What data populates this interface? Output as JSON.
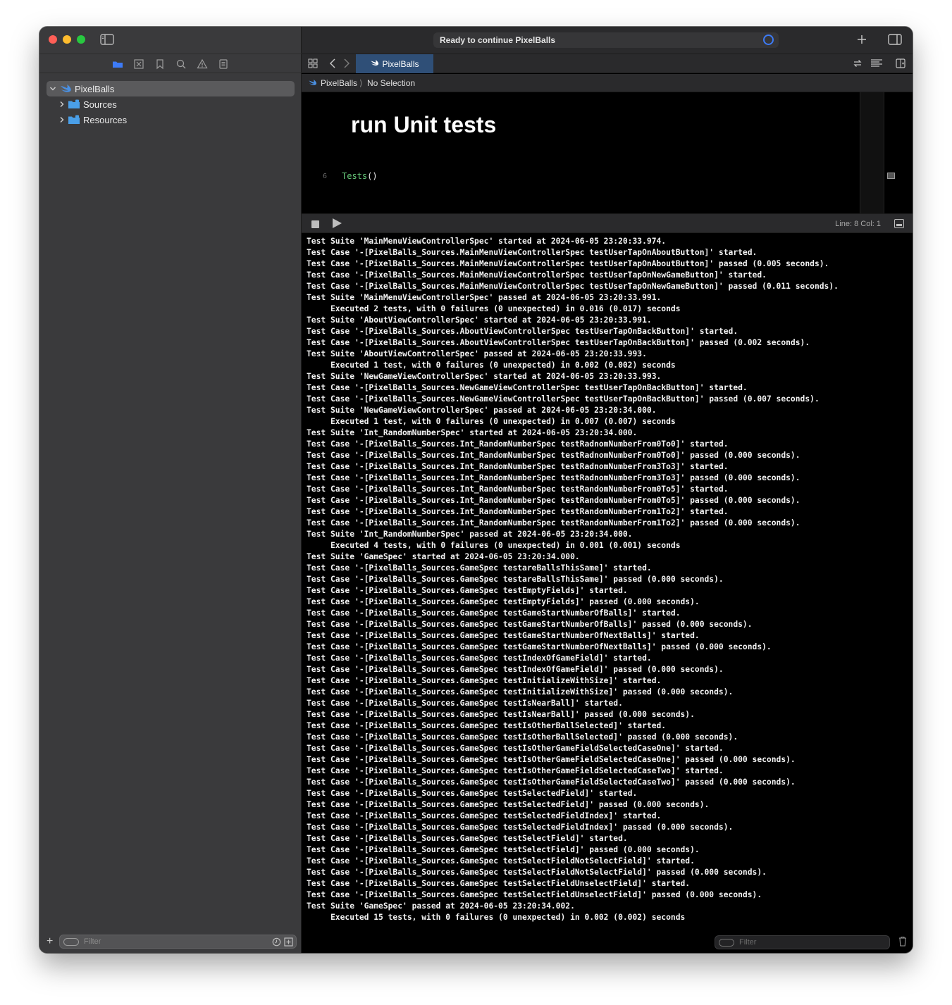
{
  "window": {
    "traffic_lights": [
      "close",
      "minimize",
      "zoom"
    ]
  },
  "navigator": {
    "icons": [
      "folder-icon",
      "source-control-icon",
      "bookmark-icon",
      "find-icon",
      "issue-icon",
      "report-icon"
    ],
    "tree": [
      {
        "label": "PixelBalls",
        "type": "project",
        "expanded": true,
        "selected": true
      },
      {
        "label": "Sources",
        "type": "folder",
        "expanded": false
      },
      {
        "label": "Resources",
        "type": "folder",
        "expanded": false
      }
    ],
    "filter_placeholder": "Filter"
  },
  "toolbar": {
    "activity_text": "Ready to continue PixelBalls",
    "accent_color": "#3d7bf7"
  },
  "tabs": [
    {
      "label": "PixelBalls",
      "active": true
    }
  ],
  "jumpbar": {
    "project": "PixelBalls",
    "selection": "No Selection"
  },
  "editor": {
    "heading": "run Unit tests",
    "line_number": "6",
    "code_fn": "Tests",
    "code_rest": "()"
  },
  "debug": {
    "line_col": "Line: 8  Col: 1"
  },
  "console": {
    "filter_placeholder": "Filter",
    "lines": [
      "Test Suite 'MainMenuViewControllerSpec' started at 2024-06-05 23:20:33.974.",
      "Test Case '-[PixelBalls_Sources.MainMenuViewControllerSpec testUserTapOnAboutButton]' started.",
      "Test Case '-[PixelBalls_Sources.MainMenuViewControllerSpec testUserTapOnAboutButton]' passed (0.005 seconds).",
      "Test Case '-[PixelBalls_Sources.MainMenuViewControllerSpec testUserTapOnNewGameButton]' started.",
      "Test Case '-[PixelBalls_Sources.MainMenuViewControllerSpec testUserTapOnNewGameButton]' passed (0.011 seconds).",
      "Test Suite 'MainMenuViewControllerSpec' passed at 2024-06-05 23:20:33.991.",
      "     Executed 2 tests, with 0 failures (0 unexpected) in 0.016 (0.017) seconds",
      "Test Suite 'AboutViewControllerSpec' started at 2024-06-05 23:20:33.991.",
      "Test Case '-[PixelBalls_Sources.AboutViewControllerSpec testUserTapOnBackButton]' started.",
      "Test Case '-[PixelBalls_Sources.AboutViewControllerSpec testUserTapOnBackButton]' passed (0.002 seconds).",
      "Test Suite 'AboutViewControllerSpec' passed at 2024-06-05 23:20:33.993.",
      "     Executed 1 test, with 0 failures (0 unexpected) in 0.002 (0.002) seconds",
      "Test Suite 'NewGameViewControllerSpec' started at 2024-06-05 23:20:33.993.",
      "Test Case '-[PixelBalls_Sources.NewGameViewControllerSpec testUserTapOnBackButton]' started.",
      "Test Case '-[PixelBalls_Sources.NewGameViewControllerSpec testUserTapOnBackButton]' passed (0.007 seconds).",
      "Test Suite 'NewGameViewControllerSpec' passed at 2024-06-05 23:20:34.000.",
      "     Executed 1 test, with 0 failures (0 unexpected) in 0.007 (0.007) seconds",
      "Test Suite 'Int_RandomNumberSpec' started at 2024-06-05 23:20:34.000.",
      "Test Case '-[PixelBalls_Sources.Int_RandomNumberSpec testRadnomNumberFrom0To0]' started.",
      "Test Case '-[PixelBalls_Sources.Int_RandomNumberSpec testRadnomNumberFrom0To0]' passed (0.000 seconds).",
      "Test Case '-[PixelBalls_Sources.Int_RandomNumberSpec testRadnomNumberFrom3To3]' started.",
      "Test Case '-[PixelBalls_Sources.Int_RandomNumberSpec testRadnomNumberFrom3To3]' passed (0.000 seconds).",
      "Test Case '-[PixelBalls_Sources.Int_RandomNumberSpec testRandomNumberFrom0To5]' started.",
      "Test Case '-[PixelBalls_Sources.Int_RandomNumberSpec testRandomNumberFrom0To5]' passed (0.000 seconds).",
      "Test Case '-[PixelBalls_Sources.Int_RandomNumberSpec testRandomNumberFrom1To2]' started.",
      "Test Case '-[PixelBalls_Sources.Int_RandomNumberSpec testRandomNumberFrom1To2]' passed (0.000 seconds).",
      "Test Suite 'Int_RandomNumberSpec' passed at 2024-06-05 23:20:34.000.",
      "     Executed 4 tests, with 0 failures (0 unexpected) in 0.001 (0.001) seconds",
      "Test Suite 'GameSpec' started at 2024-06-05 23:20:34.000.",
      "Test Case '-[PixelBalls_Sources.GameSpec testareBallsThisSame]' started.",
      "Test Case '-[PixelBalls_Sources.GameSpec testareBallsThisSame]' passed (0.000 seconds).",
      "Test Case '-[PixelBalls_Sources.GameSpec testEmptyFields]' started.",
      "Test Case '-[PixelBalls_Sources.GameSpec testEmptyFields]' passed (0.000 seconds).",
      "Test Case '-[PixelBalls_Sources.GameSpec testGameStartNumberOfBalls]' started.",
      "Test Case '-[PixelBalls_Sources.GameSpec testGameStartNumberOfBalls]' passed (0.000 seconds).",
      "Test Case '-[PixelBalls_Sources.GameSpec testGameStartNumberOfNextBalls]' started.",
      "Test Case '-[PixelBalls_Sources.GameSpec testGameStartNumberOfNextBalls]' passed (0.000 seconds).",
      "Test Case '-[PixelBalls_Sources.GameSpec testIndexOfGameField]' started.",
      "Test Case '-[PixelBalls_Sources.GameSpec testIndexOfGameField]' passed (0.000 seconds).",
      "Test Case '-[PixelBalls_Sources.GameSpec testInitializeWithSize]' started.",
      "Test Case '-[PixelBalls_Sources.GameSpec testInitializeWithSize]' passed (0.000 seconds).",
      "Test Case '-[PixelBalls_Sources.GameSpec testIsNearBall]' started.",
      "Test Case '-[PixelBalls_Sources.GameSpec testIsNearBall]' passed (0.000 seconds).",
      "Test Case '-[PixelBalls_Sources.GameSpec testIsOtherBallSelected]' started.",
      "Test Case '-[PixelBalls_Sources.GameSpec testIsOtherBallSelected]' passed (0.000 seconds).",
      "Test Case '-[PixelBalls_Sources.GameSpec testIsOtherGameFieldSelectedCaseOne]' started.",
      "Test Case '-[PixelBalls_Sources.GameSpec testIsOtherGameFieldSelectedCaseOne]' passed (0.000 seconds).",
      "Test Case '-[PixelBalls_Sources.GameSpec testIsOtherGameFieldSelectedCaseTwo]' started.",
      "Test Case '-[PixelBalls_Sources.GameSpec testIsOtherGameFieldSelectedCaseTwo]' passed (0.000 seconds).",
      "Test Case '-[PixelBalls_Sources.GameSpec testSelectedField]' started.",
      "Test Case '-[PixelBalls_Sources.GameSpec testSelectedField]' passed (0.000 seconds).",
      "Test Case '-[PixelBalls_Sources.GameSpec testSelectedFieldIndex]' started.",
      "Test Case '-[PixelBalls_Sources.GameSpec testSelectedFieldIndex]' passed (0.000 seconds).",
      "Test Case '-[PixelBalls_Sources.GameSpec testSelectField]' started.",
      "Test Case '-[PixelBalls_Sources.GameSpec testSelectField]' passed (0.000 seconds).",
      "Test Case '-[PixelBalls_Sources.GameSpec testSelectFieldNotSelectField]' started.",
      "Test Case '-[PixelBalls_Sources.GameSpec testSelectFieldNotSelectField]' passed (0.000 seconds).",
      "Test Case '-[PixelBalls_Sources.GameSpec testSelectFieldUnselectField]' started.",
      "Test Case '-[PixelBalls_Sources.GameSpec testSelectFieldUnselectField]' passed (0.000 seconds).",
      "Test Suite 'GameSpec' passed at 2024-06-05 23:20:34.002.",
      "     Executed 15 tests, with 0 failures (0 unexpected) in 0.002 (0.002) seconds"
    ]
  }
}
